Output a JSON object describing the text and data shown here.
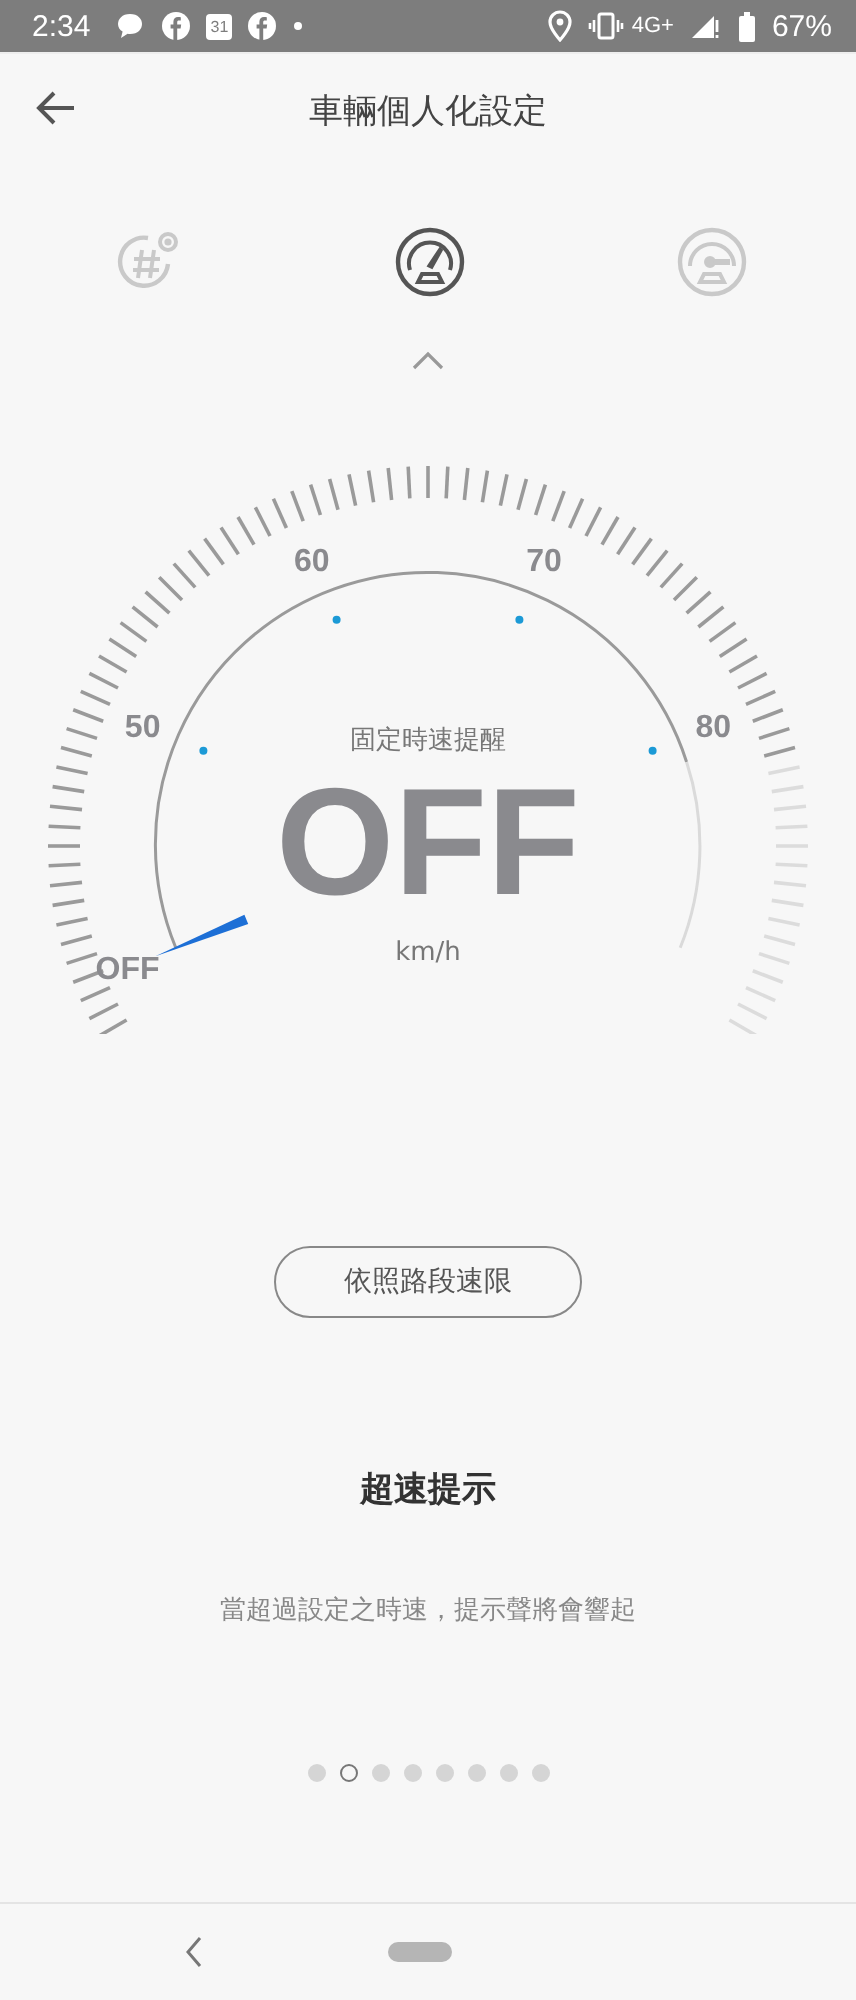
{
  "status_bar": {
    "time": "2:34",
    "calendar_day": "31",
    "network": "4G+",
    "battery": "67%"
  },
  "header": {
    "title": "車輛個人化設定"
  },
  "feature_tabs": [
    {
      "kind": "hash",
      "selected": false
    },
    {
      "kind": "speedometer",
      "selected": true
    },
    {
      "kind": "gauge",
      "selected": false
    }
  ],
  "gauge": {
    "caption": "固定時速提醒",
    "value": "OFF",
    "unit": "km/h",
    "scale_labels": [
      "OFF",
      "50",
      "60",
      "70",
      "80"
    ]
  },
  "road_limit_button": "依照路段速限",
  "section_title": "超速提示",
  "description": "當超過設定之時速，提示聲將會響起",
  "pager": [
    {
      "selected": false
    },
    {
      "selected": true
    },
    {
      "selected": false
    },
    {
      "selected": false
    },
    {
      "selected": false
    },
    {
      "selected": false
    },
    {
      "selected": false
    },
    {
      "selected": false
    }
  ]
}
